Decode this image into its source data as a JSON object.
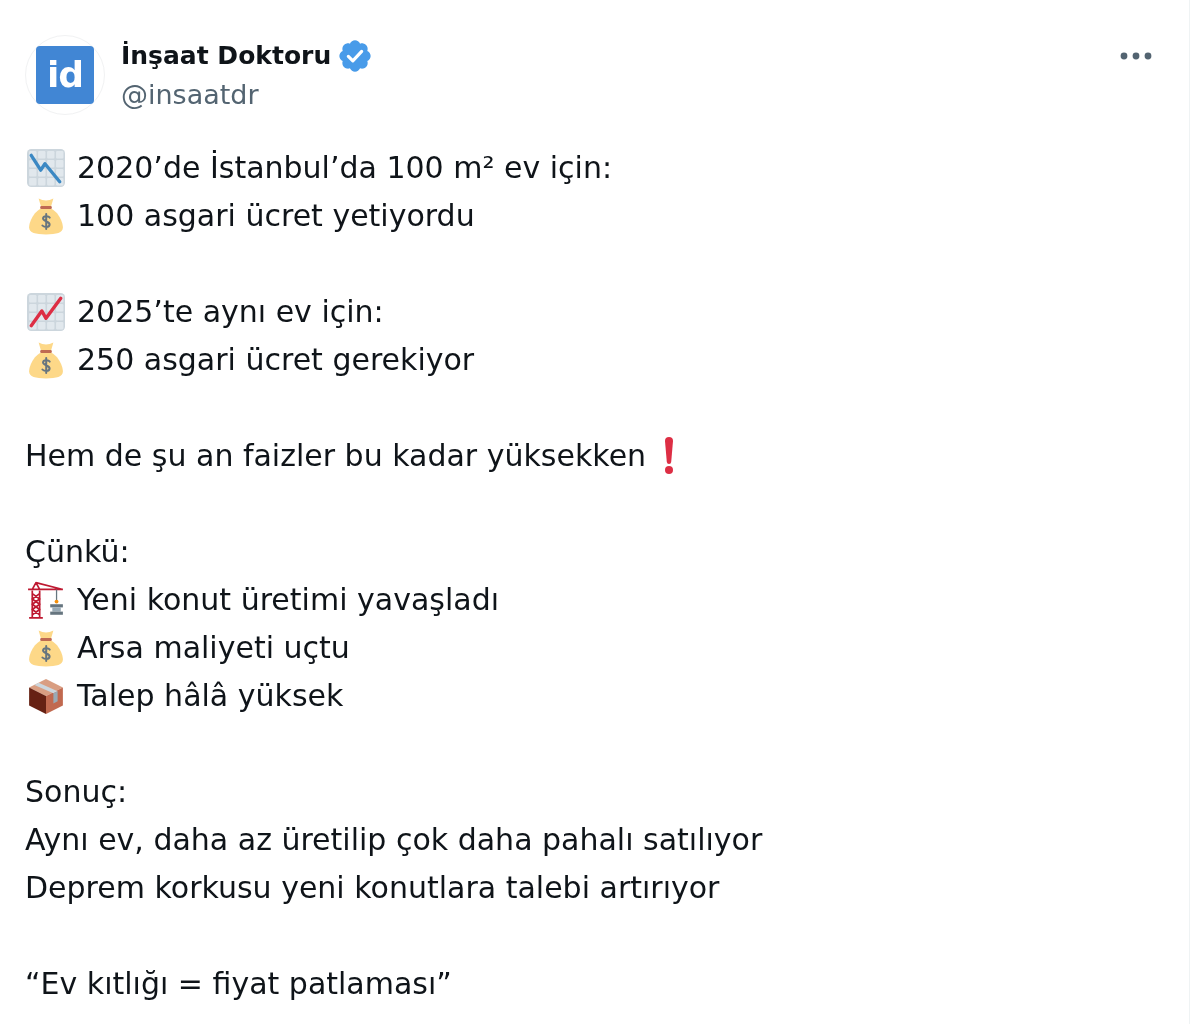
{
  "post": {
    "avatar": {
      "logo_text": "id"
    },
    "author": {
      "name": "İnşaat Doktoru",
      "verified": true,
      "handle": "@insaatdr"
    },
    "paragraphs": [
      {
        "lines": [
          {
            "kind": "falling",
            "text": "2020’de İstanbul’da 100 m² ev için:"
          },
          {
            "kind": "moneybag",
            "text": "100 asgari ücret yetiyordu"
          }
        ]
      },
      {
        "lines": [
          {
            "kind": "rising",
            "text": "2025’te aynı ev için:"
          },
          {
            "kind": "moneybag",
            "text": "250 asgari ücret gerekiyor"
          }
        ]
      },
      {
        "lines": [
          {
            "kind": "alert",
            "text": "Hem de şu an faizler bu kadar yüksekken"
          }
        ]
      },
      {
        "lines": [
          {
            "kind": "plain",
            "text": "Çünkü:"
          },
          {
            "kind": "crane",
            "text": "Yeni konut üretimi yavaşladı"
          },
          {
            "kind": "moneybag",
            "text": "Arsa maliyeti uçtu"
          },
          {
            "kind": "package",
            "text": "Talep hâlâ yüksek"
          }
        ]
      },
      {
        "lines": [
          {
            "kind": "plain",
            "text": "Sonuç:"
          },
          {
            "kind": "plain",
            "text": "Aynı ev, daha az üretilip çok daha pahalı satılıyor"
          },
          {
            "kind": "plain",
            "text": "Deprem korkusu yeni konutlara talebi artırıyor"
          }
        ]
      },
      {
        "lines": [
          {
            "kind": "plain",
            "text": "“Ev kıtlığı = fiyat patlaması”"
          }
        ]
      }
    ]
  }
}
